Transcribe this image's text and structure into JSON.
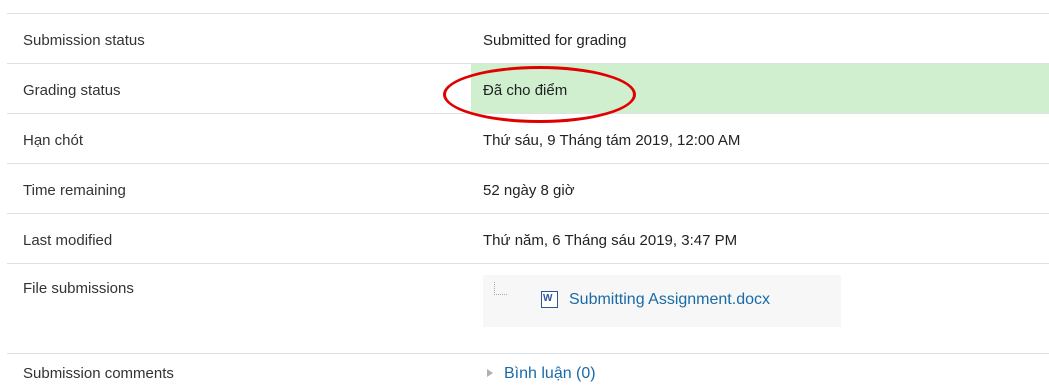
{
  "rows": {
    "submission_status": {
      "label": "Submission status",
      "value": "Submitted for grading"
    },
    "grading_status": {
      "label": "Grading status",
      "value": "Đã cho điểm"
    },
    "due_date": {
      "label": "Hạn chót",
      "value": "Thứ sáu, 9 Tháng tám 2019, 12:00 AM"
    },
    "time_remaining": {
      "label": "Time remaining",
      "value": "52 ngày 8 giờ"
    },
    "last_modified": {
      "label": "Last modified",
      "value": "Thứ năm, 6 Tháng sáu 2019, 3:47 PM"
    },
    "file_submissions": {
      "label": "File submissions",
      "file_name": "Submitting Assignment.docx",
      "file_icon": "word-doc-icon",
      "file_icon_glyph": "W"
    },
    "submission_comments": {
      "label": "Submission comments",
      "link": "Bình luận (0)"
    }
  },
  "colors": {
    "graded_background": "#cfefcf",
    "link": "#1a6aa6",
    "annotation": "#e00000"
  },
  "annotation": {
    "shape": "ellipse",
    "target": "grading_status"
  }
}
